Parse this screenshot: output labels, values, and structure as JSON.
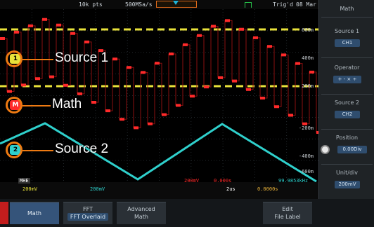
{
  "topbar": {
    "points": "10k pts",
    "sample_rate": "500MSa/s",
    "trigger_status": "Trig'd",
    "date": "08 Mar"
  },
  "menu": {
    "title": "Math",
    "source1_label": "Source 1",
    "source1_value": "CH1",
    "operator_label": "Operator",
    "operator_value": "+ - × ÷",
    "source2_label": "Source 2",
    "source2_value": "CH2",
    "position_label": "Position",
    "position_value": "0.00Div",
    "unitdiv_label": "Unit/div",
    "unitdiv_value": "200mV"
  },
  "scale_labels": [
    "600m",
    "400m",
    "200m",
    "-200m",
    "-400m",
    "-600m"
  ],
  "infobar": {
    "mode_label": "MHE",
    "ch1_scale": "200mV",
    "ch2_scale": "200mV",
    "math_scale": "200mV",
    "math_pos": "0.000s",
    "timebase": "2us",
    "horizontal_pos": "0.0000s",
    "frequency": "99.9853kHz"
  },
  "softkeys": {
    "math": "Math",
    "fft_top": "FFT",
    "fft_bottom": "FFT Overlaid",
    "advanced_top": "Advanced",
    "advanced_bottom": "Math",
    "edit_top": "Edit",
    "edit_bottom": "File Label"
  },
  "annotations": {
    "source1": "Source 1",
    "math": "Math",
    "source2": "Source 2"
  },
  "markers": {
    "ch1": "1",
    "math": "M",
    "ch2": "2"
  },
  "colors": {
    "ch1": "#e8e23a",
    "ch2": "#2fd0cc",
    "math": "#ff2a2a",
    "annotation": "#ee7a12",
    "accent": "#2f4d6e"
  }
}
